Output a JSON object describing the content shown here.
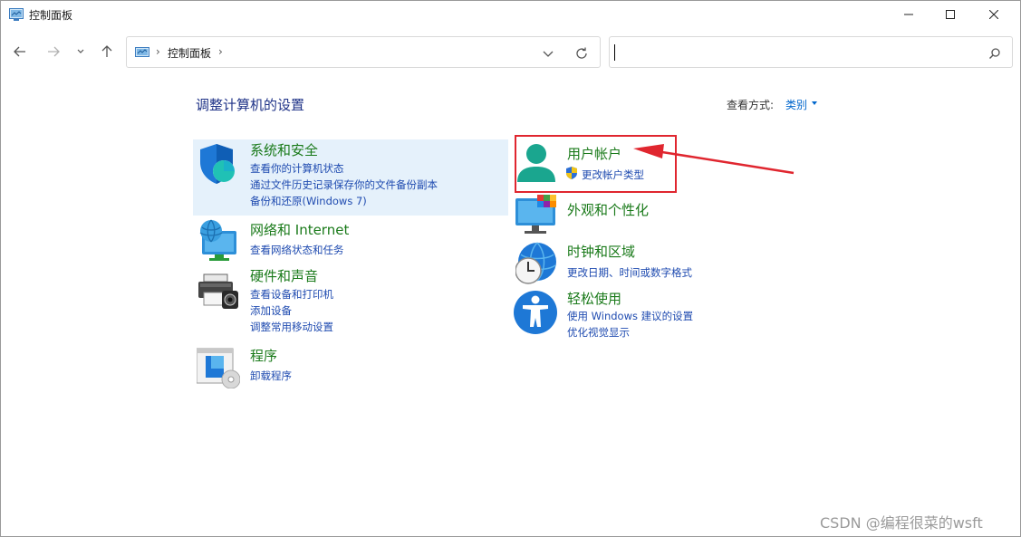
{
  "window": {
    "title": "控制面板",
    "controls": {
      "minimize": "minimize-icon",
      "maximize": "maximize-icon",
      "close": "close-icon"
    }
  },
  "address": {
    "separator": "›",
    "crumbs": [
      "控制面板"
    ]
  },
  "search": {
    "value": "",
    "placeholder": ""
  },
  "content": {
    "title": "调整计算机的设置",
    "view_label": "查看方式:",
    "view_value": "类别"
  },
  "categories": {
    "system_security": {
      "title": "系统和安全",
      "links": [
        "查看你的计算机状态",
        "通过文件历史记录保存你的文件备份副本",
        "备份和还原(Windows 7)"
      ],
      "icon": "shield-icon"
    },
    "network": {
      "title": "网络和 Internet",
      "links": [
        "查看网络状态和任务"
      ],
      "icon": "network-globe-icon"
    },
    "hardware": {
      "title": "硬件和声音",
      "links": [
        "查看设备和打印机",
        "添加设备",
        "调整常用移动设置"
      ],
      "icon": "printer-icon"
    },
    "programs": {
      "title": "程序",
      "links": [
        "卸载程序"
      ],
      "icon": "programs-disc-icon"
    },
    "user_accounts": {
      "title": "用户帐户",
      "links": [
        "更改帐户类型"
      ],
      "icon": "user-icon"
    },
    "appearance": {
      "title": "外观和个性化",
      "links": [],
      "icon": "monitor-palette-icon"
    },
    "clock_region": {
      "title": "时钟和区域",
      "links": [
        "更改日期、时间或数字格式"
      ],
      "icon": "globe-clock-icon"
    },
    "ease_access": {
      "title": "轻松使用",
      "links": [
        "使用 Windows 建议的设置",
        "优化视觉显示"
      ],
      "icon": "accessibility-icon"
    }
  },
  "watermark": "CSDN @编程很菜的wsft",
  "colors": {
    "title_blue": "#1e3287",
    "category_green": "#1a7a1a",
    "link_blue": "#1f4bb0",
    "annotation_red": "#e0262f",
    "hover_bg": "#e5f1fb"
  }
}
